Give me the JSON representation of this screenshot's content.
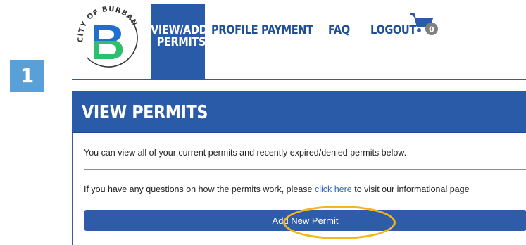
{
  "step": {
    "number": "1",
    "color": "#5aa0d8"
  },
  "logo": {
    "text_curve": "CITY OF BURBANK",
    "letter": "B",
    "colors": {
      "blue": "#1f6fd1",
      "green": "#2ebf6c",
      "ring": "#333333"
    }
  },
  "nav": {
    "items": [
      {
        "label_line1": "VIEW/ADD",
        "label_line2": "PERMITS",
        "active": true
      },
      {
        "label": "PROFILE"
      },
      {
        "label": "PAYMENT"
      },
      {
        "label": "FAQ"
      },
      {
        "label": "LOGOUT"
      }
    ],
    "cart": {
      "icon": "cart-icon",
      "count": "0"
    },
    "colors": {
      "text": "#1f4f97",
      "active_bg": "#2a5ba8"
    }
  },
  "panel": {
    "title": "VIEW PERMITS",
    "description": "You can view all of your current permits and recently expired/denied permits below.",
    "questions_prefix": "If you have any questions on how the permits work, please ",
    "questions_link": "click here",
    "questions_suffix": " to visit our informational page",
    "add_button": "Add New Permit",
    "colors": {
      "header": "#2a5ba8",
      "link": "#2f62b8",
      "highlight": "#f3b61b"
    }
  }
}
